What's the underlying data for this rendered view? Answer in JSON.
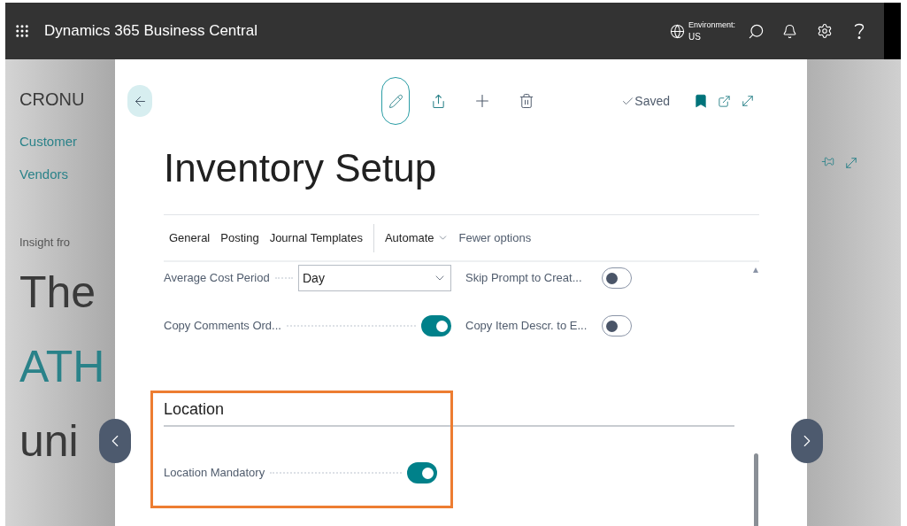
{
  "app": {
    "title": "Dynamics 365 Business Central",
    "environment_label": "Environment:",
    "environment_value": "US"
  },
  "background_page": {
    "company": "CRONU",
    "links": [
      "Customer",
      "Vendors"
    ],
    "insight": "Insight fro",
    "headline": [
      {
        "text": "The",
        "kind": "plain"
      },
      {
        "text": "ATH",
        "kind": "accent"
      },
      {
        "text": "uni",
        "kind": "plain"
      }
    ]
  },
  "dialog": {
    "status": "Saved",
    "title": "Inventory Setup",
    "tabs": [
      {
        "label": "General",
        "kind": "tab"
      },
      {
        "label": "Posting",
        "kind": "tab"
      },
      {
        "label": "Journal Templates",
        "kind": "tab"
      },
      {
        "label": "Automate",
        "kind": "menu"
      },
      {
        "label": "Fewer options",
        "kind": "link"
      }
    ],
    "fields": [
      {
        "label": "Average Cost Period",
        "kind": "select",
        "value": "Day"
      },
      {
        "label": "Skip Prompt to Creat...",
        "kind": "toggle",
        "on": false
      },
      {
        "label": "Copy Comments Ord...",
        "kind": "toggle",
        "on": true
      },
      {
        "label": "Copy Item Descr. to E...",
        "kind": "toggle",
        "on": false
      }
    ],
    "location": {
      "heading": "Location",
      "highlighted": true,
      "fields": [
        {
          "label": "Location Mandatory",
          "kind": "toggle",
          "on": true
        }
      ]
    }
  }
}
